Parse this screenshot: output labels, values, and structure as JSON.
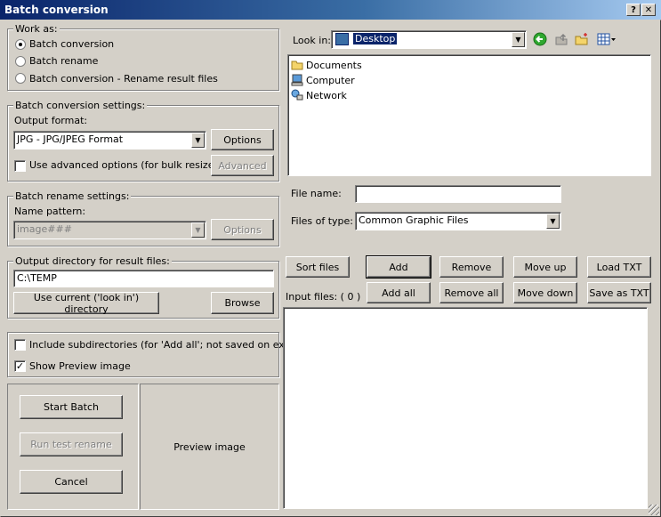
{
  "window": {
    "title": "Batch conversion",
    "help_button": "?",
    "close_button": "✕"
  },
  "work_as": {
    "legend": "Work as:",
    "options": [
      "Batch conversion",
      "Batch rename",
      "Batch conversion - Rename result files"
    ],
    "selected_index": 0
  },
  "conversion_settings": {
    "legend": "Batch conversion settings:",
    "output_format_label": "Output format:",
    "output_format_value": "JPG - JPG/JPEG Format",
    "options_button": "Options",
    "advanced_checkbox_label": "Use advanced options (for bulk resize...)",
    "advanced_checked": false,
    "advanced_button": "Advanced"
  },
  "rename_settings": {
    "legend": "Batch rename settings:",
    "name_pattern_label": "Name pattern:",
    "name_pattern_value": "image###",
    "options_button": "Options"
  },
  "output_dir": {
    "legend": "Output directory for result files:",
    "value": "C:\\TEMP",
    "use_current_button": "Use current ('look in') directory",
    "browse_button": "Browse"
  },
  "extra_options": {
    "include_subdirs_label": "Include subdirectories (for 'Add all'; not saved on exit)",
    "include_subdirs_checked": false,
    "show_preview_label": "Show Preview image",
    "show_preview_checked": true
  },
  "actions": {
    "start_batch": "Start Batch",
    "run_test_rename": "Run test rename",
    "cancel": "Cancel"
  },
  "preview": {
    "label": "Preview image"
  },
  "file_browser": {
    "look_in_label": "Look in:",
    "look_in_value": "Desktop",
    "items": [
      {
        "label": "Documents",
        "icon": "folder-icon"
      },
      {
        "label": "Computer",
        "icon": "computer-icon"
      },
      {
        "label": "Network",
        "icon": "network-icon"
      }
    ],
    "file_name_label": "File name:",
    "file_name_value": "",
    "files_of_type_label": "Files of type:",
    "files_of_type_value": "Common Graphic Files"
  },
  "file_actions": {
    "sort_files": "Sort files",
    "add": "Add",
    "remove": "Remove",
    "move_up": "Move up",
    "load_txt": "Load TXT",
    "add_all": "Add all",
    "remove_all": "Remove all",
    "move_down": "Move down",
    "save_as_txt": "Save as TXT"
  },
  "input_files": {
    "label": "Input files: ( 0 )"
  }
}
